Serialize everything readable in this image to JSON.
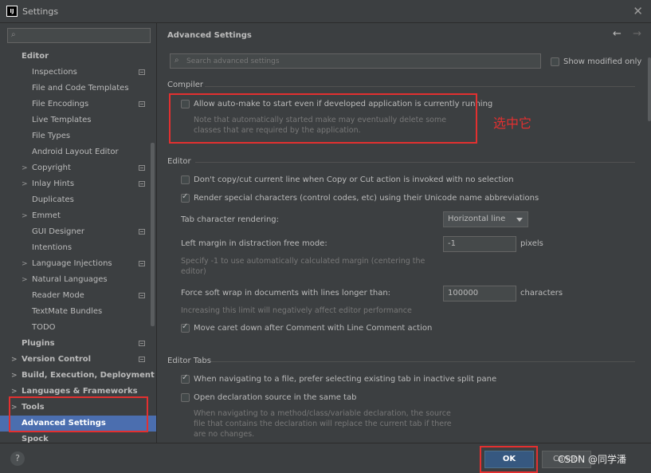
{
  "window": {
    "title": "Settings",
    "app_icon": "IJ"
  },
  "sidebar": {
    "search_placeholder": "",
    "items": [
      {
        "label": "Editor",
        "level": 0,
        "bold": true,
        "arrow": "",
        "badge": false,
        "selected": false
      },
      {
        "label": "Inspections",
        "level": 1,
        "bold": false,
        "arrow": "",
        "badge": true,
        "selected": false
      },
      {
        "label": "File and Code Templates",
        "level": 1,
        "bold": false,
        "arrow": "",
        "badge": false,
        "selected": false
      },
      {
        "label": "File Encodings",
        "level": 1,
        "bold": false,
        "arrow": "",
        "badge": true,
        "selected": false
      },
      {
        "label": "Live Templates",
        "level": 1,
        "bold": false,
        "arrow": "",
        "badge": false,
        "selected": false
      },
      {
        "label": "File Types",
        "level": 1,
        "bold": false,
        "arrow": "",
        "badge": false,
        "selected": false
      },
      {
        "label": "Android Layout Editor",
        "level": 1,
        "bold": false,
        "arrow": "",
        "badge": false,
        "selected": false
      },
      {
        "label": "Copyright",
        "level": 1,
        "bold": false,
        "arrow": ">",
        "badge": true,
        "selected": false
      },
      {
        "label": "Inlay Hints",
        "level": 1,
        "bold": false,
        "arrow": ">",
        "badge": true,
        "selected": false
      },
      {
        "label": "Duplicates",
        "level": 1,
        "bold": false,
        "arrow": "",
        "badge": false,
        "selected": false
      },
      {
        "label": "Emmet",
        "level": 1,
        "bold": false,
        "arrow": ">",
        "badge": false,
        "selected": false
      },
      {
        "label": "GUI Designer",
        "level": 1,
        "bold": false,
        "arrow": "",
        "badge": true,
        "selected": false
      },
      {
        "label": "Intentions",
        "level": 1,
        "bold": false,
        "arrow": "",
        "badge": false,
        "selected": false
      },
      {
        "label": "Language Injections",
        "level": 1,
        "bold": false,
        "arrow": ">",
        "badge": true,
        "selected": false
      },
      {
        "label": "Natural Languages",
        "level": 1,
        "bold": false,
        "arrow": ">",
        "badge": false,
        "selected": false
      },
      {
        "label": "Reader Mode",
        "level": 1,
        "bold": false,
        "arrow": "",
        "badge": true,
        "selected": false
      },
      {
        "label": "TextMate Bundles",
        "level": 1,
        "bold": false,
        "arrow": "",
        "badge": false,
        "selected": false
      },
      {
        "label": "TODO",
        "level": 1,
        "bold": false,
        "arrow": "",
        "badge": false,
        "selected": false
      },
      {
        "label": "Plugins",
        "level": 0,
        "bold": true,
        "arrow": "",
        "badge": true,
        "selected": false
      },
      {
        "label": "Version Control",
        "level": 0,
        "bold": true,
        "arrow": ">",
        "badge": true,
        "selected": false
      },
      {
        "label": "Build, Execution, Deployment",
        "level": 0,
        "bold": true,
        "arrow": ">",
        "badge": false,
        "selected": false
      },
      {
        "label": "Languages & Frameworks",
        "level": 0,
        "bold": true,
        "arrow": ">",
        "badge": false,
        "selected": false
      },
      {
        "label": "Tools",
        "level": 0,
        "bold": true,
        "arrow": ">",
        "badge": false,
        "selected": false
      },
      {
        "label": "Advanced Settings",
        "level": 0,
        "bold": true,
        "arrow": "",
        "badge": false,
        "selected": true
      },
      {
        "label": "Spock",
        "level": 0,
        "bold": true,
        "arrow": "",
        "badge": false,
        "selected": false
      }
    ]
  },
  "main": {
    "title": "Advanced Settings",
    "search_placeholder": "Search advanced settings",
    "show_modified_label": "Show modified only",
    "annotation": "选中它",
    "compiler": {
      "title": "Compiler",
      "auto_make_label": "Allow auto-make to start even if developed application is currently running",
      "auto_make_checked": false,
      "auto_make_hint_1": "Note that automatically started make may eventually delete some",
      "auto_make_hint_2": "classes that are required by the application."
    },
    "editor": {
      "title": "Editor",
      "copy_cut_label": "Don't copy/cut current line when Copy or Cut action is invoked with no selection",
      "copy_cut_checked": false,
      "render_special_label": "Render special characters (control codes, etc) using their Unicode name abbreviations",
      "render_special_checked": true,
      "tab_render_label": "Tab character rendering:",
      "tab_render_value": "Horizontal line",
      "left_margin_label": "Left margin in distraction free mode:",
      "left_margin_value": "-1",
      "left_margin_unit": "pixels",
      "left_margin_hint_1": "Specify -1 to use automatically calculated margin (centering the",
      "left_margin_hint_2": "editor)",
      "soft_wrap_label": "Force soft wrap in documents with lines longer than:",
      "soft_wrap_value": "100000",
      "soft_wrap_unit": "characters",
      "soft_wrap_hint": "Increasing this limit will negatively affect editor performance",
      "move_caret_label": "Move caret down after Comment with Line Comment action",
      "move_caret_checked": true
    },
    "editor_tabs": {
      "title": "Editor Tabs",
      "prefer_existing_label": "When navigating to a file, prefer selecting existing tab in inactive split pane",
      "prefer_existing_checked": true,
      "declaration_label": "Open declaration source in the same tab",
      "declaration_checked": false,
      "declaration_hint_1": "When navigating to a method/class/variable declaration, the source",
      "declaration_hint_2": "file that contains the declaration will replace the current tab if there",
      "declaration_hint_3": "are no changes."
    }
  },
  "footer": {
    "help_label": "?",
    "ok_label": "OK",
    "cancel_label": "Cancel",
    "watermark": "CSDN @同学潘"
  },
  "colors": {
    "background": "#3c3f41",
    "selection": "#4b6eaf",
    "ok_button": "#365880",
    "highlight_red": "#e33030"
  }
}
